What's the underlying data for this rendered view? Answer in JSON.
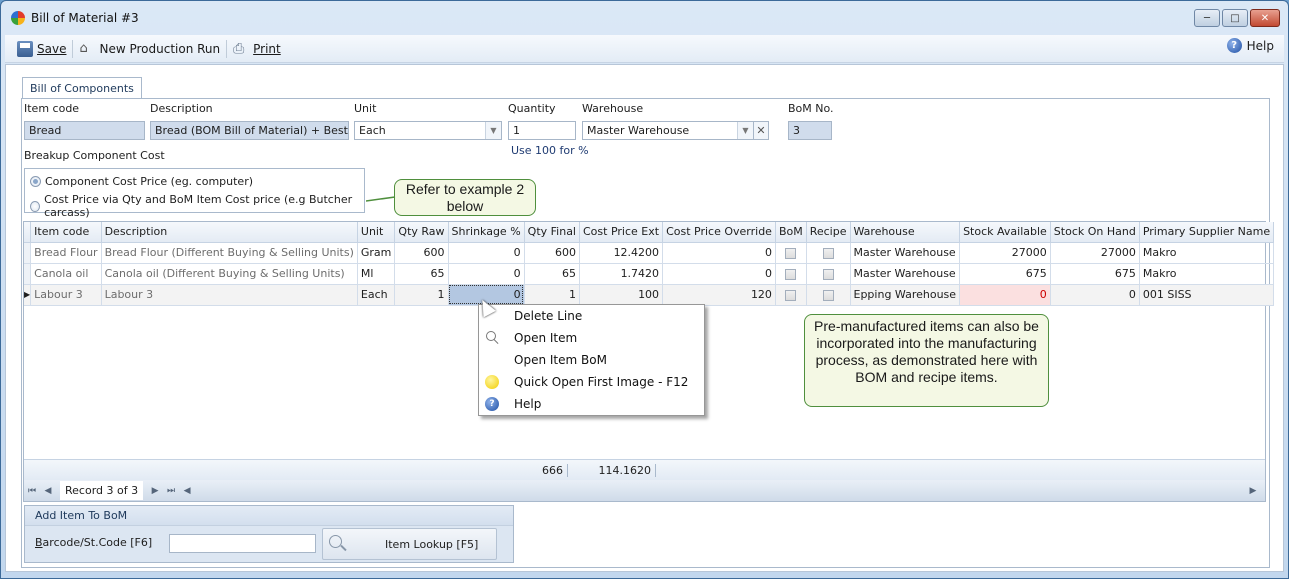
{
  "window": {
    "title": "Bill of Material #3",
    "controls": [
      "minimize",
      "maximize",
      "close"
    ]
  },
  "toolbar": {
    "save_label": "Save",
    "new_production_run_label": "New Production Run",
    "print_label": "Print",
    "help_label": "Help"
  },
  "tabs": [
    {
      "label": "Bill of Components",
      "active": true
    }
  ],
  "header": {
    "item_code_label": "Item code",
    "item_code_value": "Bread",
    "description_label": "Description",
    "description_value": "Bread (BOM Bill of Material) + Best Befor",
    "unit_label": "Unit",
    "unit_value": "Each",
    "quantity_label": "Quantity",
    "quantity_value": "1",
    "quantity_hint": "Use 100 for %",
    "warehouse_label": "Warehouse",
    "warehouse_value": "Master Warehouse",
    "bom_no_label": "BoM No.",
    "bom_no_value": "3"
  },
  "breakup": {
    "label": "Breakup Component Cost",
    "options": [
      {
        "label": "Component Cost Price (eg. computer)",
        "selected": true
      },
      {
        "label": "Cost Price via Qty and BoM Item Cost price (e.g Butcher carcass)",
        "selected": false
      }
    ]
  },
  "callouts": {
    "example": "Refer to example 2 below",
    "premanufactured": "Pre-manufactured items can also be incorporated into the manufacturing process, as demonstrated here with BOM and recipe items."
  },
  "grid": {
    "columns": [
      "Item code",
      "Description",
      "Unit",
      "Qty Raw",
      "Shrinkage %",
      "Qty Final",
      "Cost Price Ext",
      "Cost Price Override",
      "BoM",
      "Recipe",
      "Warehouse",
      "Stock Available",
      "Stock On Hand",
      "Primary Supplier Name"
    ],
    "rows": [
      {
        "item_code": "Bread Flour",
        "description": "Bread Flour (Different Buying & Selling Units)",
        "unit": "Gram",
        "qty_raw": "600",
        "shrinkage": "0",
        "qty_final": "600",
        "cost_price_ext": "12.4200",
        "cost_price_override": "0",
        "bom": false,
        "recipe": false,
        "warehouse": "Master Warehouse",
        "stock_available": "27000",
        "stock_on_hand": "27000",
        "supplier": "Makro"
      },
      {
        "item_code": "Canola oil",
        "description": "Canola oil  (Different Buying & Selling Units)",
        "unit": "Ml",
        "qty_raw": "65",
        "shrinkage": "0",
        "qty_final": "65",
        "cost_price_ext": "1.7420",
        "cost_price_override": "0",
        "bom": false,
        "recipe": false,
        "warehouse": "Master Warehouse",
        "stock_available": "675",
        "stock_on_hand": "675",
        "supplier": "Makro"
      },
      {
        "item_code": "Labour 3",
        "description": "Labour 3",
        "unit": "Each",
        "qty_raw": "1",
        "shrinkage": "0",
        "qty_final": "1",
        "cost_price_ext": "100",
        "cost_price_override": "120",
        "bom": false,
        "recipe": false,
        "warehouse": "Epping Warehouse",
        "stock_available": "0",
        "stock_on_hand": "0",
        "supplier": "001 SISS"
      }
    ],
    "totals": {
      "qty_final": "666",
      "cost_price_ext": "114.1620"
    },
    "navigator": {
      "record_text": "Record 3 of 3"
    }
  },
  "context_menu": {
    "items": [
      {
        "label": "Delete Line",
        "icon": "none"
      },
      {
        "label": "Open Item",
        "icon": "magnifier-icon"
      },
      {
        "label": "Open Item BoM",
        "icon": "none"
      },
      {
        "label": "Quick Open First Image - F12",
        "icon": "yellow-dot-icon"
      },
      {
        "label": "Help",
        "icon": "help-icon"
      }
    ]
  },
  "add_item": {
    "title": "Add Item To BoM",
    "barcode_label": "Barcode/St.Code [F6]",
    "barcode_value": "",
    "lookup_label": "Item Lookup [F5]"
  },
  "colors": {
    "accent": "#1e395b",
    "readonly_field": "#d0dcec",
    "alert_cell": "#fbe0e0",
    "callout_border": "#4f8f3d",
    "callout_fill": "#f4f8e4"
  }
}
